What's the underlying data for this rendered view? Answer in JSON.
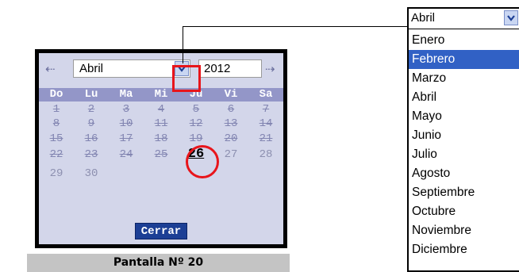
{
  "calendar": {
    "prev_arrow": "⇠",
    "next_arrow": "⇢",
    "month_value": "Abril",
    "year_value": "2012",
    "weekdays": [
      "Do",
      "Lu",
      "Ma",
      "Mi",
      "Ju",
      "Vi",
      "Sa"
    ],
    "days": {
      "w1": [
        "1",
        "2",
        "3",
        "4",
        "5",
        "6",
        "7"
      ],
      "w2": [
        "8",
        "9",
        "10",
        "11",
        "12",
        "13",
        "14"
      ],
      "w3": [
        "15",
        "16",
        "17",
        "18",
        "19",
        "20",
        "21"
      ],
      "w4": [
        "22",
        "23",
        "24",
        "25",
        "26",
        "27",
        "28"
      ],
      "w5": [
        "29",
        "30"
      ]
    },
    "today": "26",
    "close_label": "Cerrar"
  },
  "caption": "Pantalla Nº 20",
  "dropdown": {
    "current": "Abril",
    "selected": "Febrero",
    "options": [
      "Enero",
      "Febrero",
      "Marzo",
      "Abril",
      "Mayo",
      "Junio",
      "Julio",
      "Agosto",
      "Septiembre",
      "Octubre",
      "Noviembre",
      "Diciembre"
    ]
  },
  "colors": {
    "panel_bg": "#d3d6ea",
    "header_row": "#9396c8",
    "highlight_red": "#e8151b",
    "button_blue": "#1c3f95",
    "selection_blue": "#3161c5"
  }
}
